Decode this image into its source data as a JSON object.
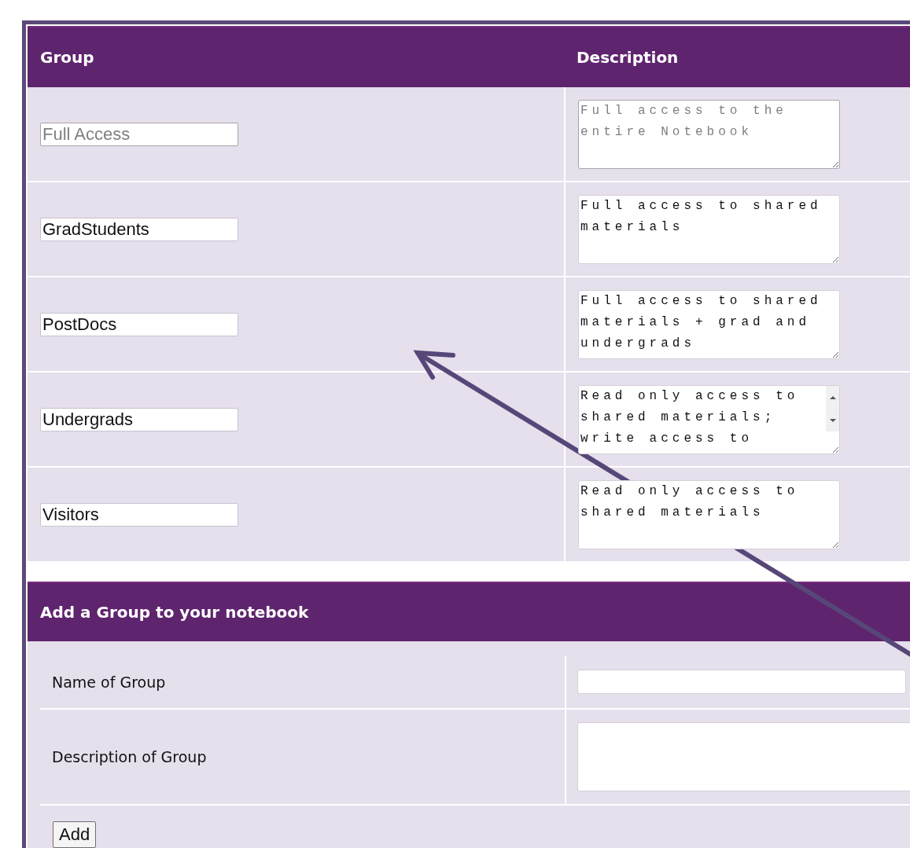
{
  "columns": [
    "Group",
    "Description"
  ],
  "groups": [
    {
      "name": "Full Access",
      "description": "Full access to the entire Notebook",
      "disabled": true,
      "scrollbar": false
    },
    {
      "name": "GradStudents",
      "description": "Full access to shared materials",
      "disabled": false,
      "scrollbar": false
    },
    {
      "name": "PostDocs",
      "description": "Full access to shared materials + grad and undergrads",
      "disabled": false,
      "scrollbar": false
    },
    {
      "name": "Undergrads",
      "description": "Read only access to shared materials; write access to",
      "disabled": false,
      "scrollbar": true
    },
    {
      "name": "Visitors",
      "description": "Read only access to shared materials",
      "disabled": false,
      "scrollbar": false
    }
  ],
  "add_form": {
    "title": "Add a Group to your notebook",
    "fields": [
      {
        "label": "Name of Group",
        "kind": "input"
      },
      {
        "label": "Description of Group",
        "kind": "textarea"
      }
    ],
    "button": "Add"
  }
}
